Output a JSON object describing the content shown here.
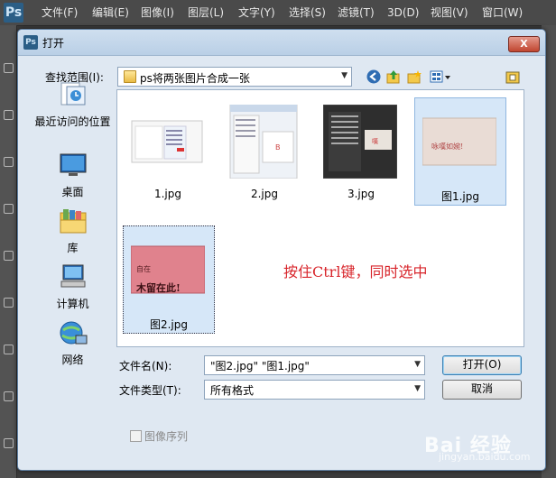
{
  "app": {
    "logo": "Ps",
    "menu": [
      "文件(F)",
      "编辑(E)",
      "图像(I)",
      "图层(L)",
      "文字(Y)",
      "选择(S)",
      "滤镜(T)",
      "3D(D)",
      "视图(V)",
      "窗口(W)"
    ]
  },
  "dialog": {
    "title": "打开",
    "close_label": "X",
    "look_in_label": "查找范围(I):",
    "look_in_value": "ps将两张图片合成一张",
    "places": [
      {
        "label": "最近访问的位置",
        "icon": "recent-places-icon"
      },
      {
        "label": "桌面",
        "icon": "desktop-icon"
      },
      {
        "label": "库",
        "icon": "libraries-icon"
      },
      {
        "label": "计算机",
        "icon": "computer-icon"
      },
      {
        "label": "网络",
        "icon": "network-icon"
      }
    ],
    "files": [
      {
        "name": "1.jpg",
        "selected": false
      },
      {
        "name": "2.jpg",
        "selected": false
      },
      {
        "name": "3.jpg",
        "selected": false
      },
      {
        "name": "图1.jpg",
        "selected": true
      },
      {
        "name": "图2.jpg",
        "selected": true
      }
    ],
    "thumb_text": {
      "line1": "自在",
      "line2": "木留在此!",
      "small": "咏嘆如婉!"
    },
    "annotation": "按住Ctrl键，同时选中",
    "filename_label": "文件名(N):",
    "filename_value": "\"图2.jpg\" \"图1.jpg\"",
    "filetype_label": "文件类型(T):",
    "filetype_value": "所有格式",
    "open_button": "打开(O)",
    "cancel_button": "取消",
    "image_sequence_label": "图像序列",
    "image_sequence_checked": false
  },
  "watermark": {
    "text": "Bai 经验",
    "sub": "jingyan.baidu.com"
  },
  "colors": {
    "accent": "#d8252b",
    "selection": "#d6e7f8",
    "close": "#c0452f"
  }
}
